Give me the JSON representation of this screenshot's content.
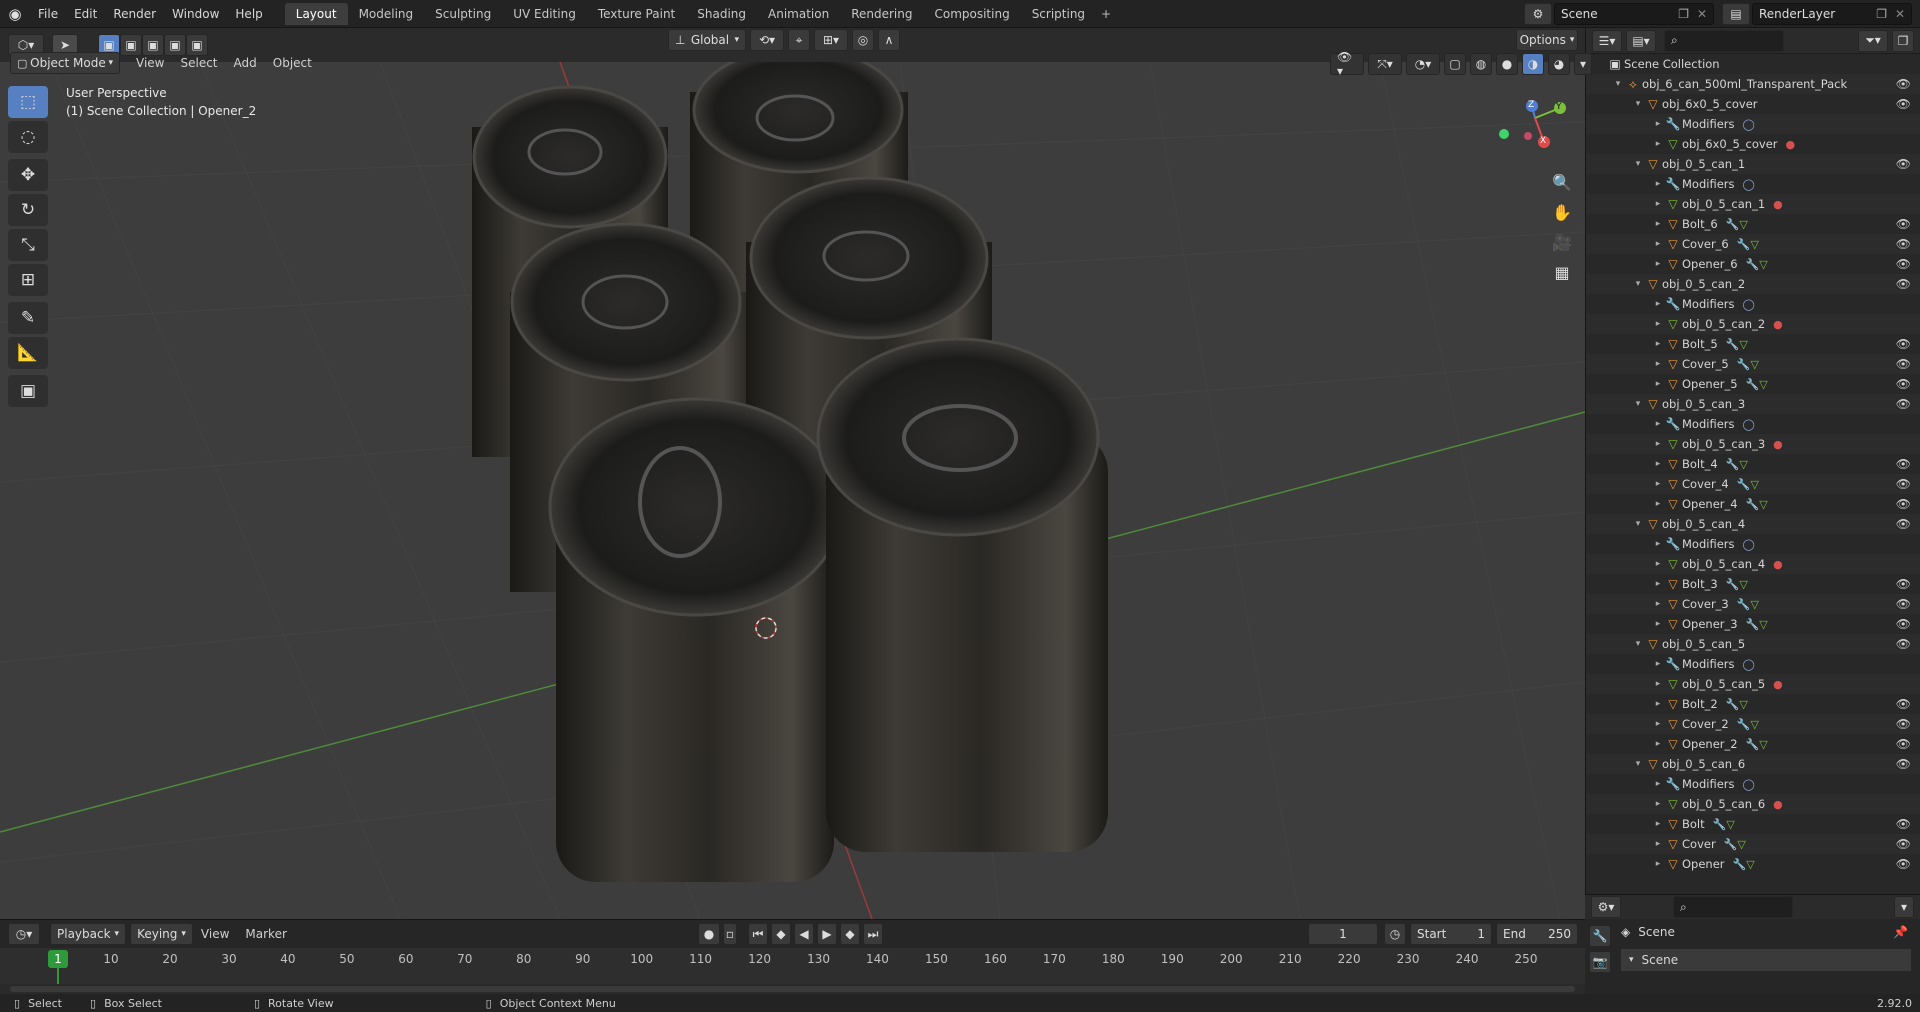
{
  "menubar": {
    "logo_icon": "blender-logo-icon",
    "items": [
      "File",
      "Edit",
      "Render",
      "Window",
      "Help"
    ]
  },
  "workspaces": {
    "tabs": [
      "Layout",
      "Modeling",
      "Sculpting",
      "UV Editing",
      "Texture Paint",
      "Shading",
      "Animation",
      "Rendering",
      "Compositing",
      "Scripting"
    ],
    "active": "Layout",
    "add": "+"
  },
  "scene": {
    "name": "Scene",
    "render_layer": "RenderLayer"
  },
  "viewport_header": {
    "mode": "Object Mode",
    "menus": [
      "View",
      "Select",
      "Add",
      "Object"
    ],
    "transform": "Global",
    "options": "Options"
  },
  "viewport": {
    "perspective": "User Perspective",
    "context": "(1) Scene Collection | Opener_2",
    "gizmo": {
      "x": "X",
      "y": "Y",
      "z": "Z"
    }
  },
  "outliner": {
    "root": "Scene Collection",
    "rows": [
      {
        "indent": 1,
        "expand": "▾",
        "icon": "empty",
        "label": "obj_6_can_500ml_Transparent_Pack",
        "eye": true
      },
      {
        "indent": 2,
        "expand": "▾",
        "icon": "object",
        "label": "obj_6x0_5_cover",
        "eye": true
      },
      {
        "indent": 3,
        "expand": "▸",
        "icon": "wrench",
        "label": "Modifiers",
        "tag": "mod",
        "eye": false
      },
      {
        "indent": 3,
        "expand": "▸",
        "icon": "mesh",
        "label": "obj_6x0_5_cover",
        "tag": "mat",
        "eye": false
      },
      {
        "indent": 2,
        "expand": "▾",
        "icon": "object",
        "label": "obj_0_5_can_1",
        "eye": true
      },
      {
        "indent": 3,
        "expand": "▸",
        "icon": "wrench",
        "label": "Modifiers",
        "tag": "mod",
        "eye": false
      },
      {
        "indent": 3,
        "expand": "▸",
        "icon": "mesh",
        "label": "obj_0_5_can_1",
        "tag": "mat",
        "eye": false
      },
      {
        "indent": 3,
        "expand": "▸",
        "icon": "object",
        "label": "Bolt_6",
        "tag": "wm",
        "eye": true
      },
      {
        "indent": 3,
        "expand": "▸",
        "icon": "object",
        "label": "Cover_6",
        "tag": "wm",
        "eye": true
      },
      {
        "indent": 3,
        "expand": "▸",
        "icon": "object",
        "label": "Opener_6",
        "tag": "wm",
        "eye": true
      },
      {
        "indent": 2,
        "expand": "▾",
        "icon": "object",
        "label": "obj_0_5_can_2",
        "eye": true
      },
      {
        "indent": 3,
        "expand": "▸",
        "icon": "wrench",
        "label": "Modifiers",
        "tag": "mod",
        "eye": false
      },
      {
        "indent": 3,
        "expand": "▸",
        "icon": "mesh",
        "label": "obj_0_5_can_2",
        "tag": "mat",
        "eye": false
      },
      {
        "indent": 3,
        "expand": "▸",
        "icon": "object",
        "label": "Bolt_5",
        "tag": "wm",
        "eye": true
      },
      {
        "indent": 3,
        "expand": "▸",
        "icon": "object",
        "label": "Cover_5",
        "tag": "wm",
        "eye": true
      },
      {
        "indent": 3,
        "expand": "▸",
        "icon": "object",
        "label": "Opener_5",
        "tag": "wm",
        "eye": true
      },
      {
        "indent": 2,
        "expand": "▾",
        "icon": "object",
        "label": "obj_0_5_can_3",
        "eye": true
      },
      {
        "indent": 3,
        "expand": "▸",
        "icon": "wrench",
        "label": "Modifiers",
        "tag": "mod",
        "eye": false
      },
      {
        "indent": 3,
        "expand": "▸",
        "icon": "mesh",
        "label": "obj_0_5_can_3",
        "tag": "mat",
        "eye": false
      },
      {
        "indent": 3,
        "expand": "▸",
        "icon": "object",
        "label": "Bolt_4",
        "tag": "wm",
        "eye": true
      },
      {
        "indent": 3,
        "expand": "▸",
        "icon": "object",
        "label": "Cover_4",
        "tag": "wm",
        "eye": true
      },
      {
        "indent": 3,
        "expand": "▸",
        "icon": "object",
        "label": "Opener_4",
        "tag": "wm",
        "eye": true
      },
      {
        "indent": 2,
        "expand": "▾",
        "icon": "object",
        "label": "obj_0_5_can_4",
        "eye": true
      },
      {
        "indent": 3,
        "expand": "▸",
        "icon": "wrench",
        "label": "Modifiers",
        "tag": "mod",
        "eye": false
      },
      {
        "indent": 3,
        "expand": "▸",
        "icon": "mesh",
        "label": "obj_0_5_can_4",
        "tag": "mat",
        "eye": false
      },
      {
        "indent": 3,
        "expand": "▸",
        "icon": "object",
        "label": "Bolt_3",
        "tag": "wm",
        "eye": true
      },
      {
        "indent": 3,
        "expand": "▸",
        "icon": "object",
        "label": "Cover_3",
        "tag": "wm",
        "eye": true
      },
      {
        "indent": 3,
        "expand": "▸",
        "icon": "object",
        "label": "Opener_3",
        "tag": "wm",
        "eye": true
      },
      {
        "indent": 2,
        "expand": "▾",
        "icon": "object",
        "label": "obj_0_5_can_5",
        "eye": true
      },
      {
        "indent": 3,
        "expand": "▸",
        "icon": "wrench",
        "label": "Modifiers",
        "tag": "mod",
        "eye": false
      },
      {
        "indent": 3,
        "expand": "▸",
        "icon": "mesh",
        "label": "obj_0_5_can_5",
        "tag": "mat",
        "eye": false
      },
      {
        "indent": 3,
        "expand": "▸",
        "icon": "object",
        "label": "Bolt_2",
        "tag": "wm",
        "eye": true
      },
      {
        "indent": 3,
        "expand": "▸",
        "icon": "object",
        "label": "Cover_2",
        "tag": "wm",
        "eye": true
      },
      {
        "indent": 3,
        "expand": "▸",
        "icon": "object",
        "label": "Opener_2",
        "tag": "wm",
        "eye": true
      },
      {
        "indent": 2,
        "expand": "▾",
        "icon": "object",
        "label": "obj_0_5_can_6",
        "eye": true
      },
      {
        "indent": 3,
        "expand": "▸",
        "icon": "wrench",
        "label": "Modifiers",
        "tag": "mod",
        "eye": false
      },
      {
        "indent": 3,
        "expand": "▸",
        "icon": "mesh",
        "label": "obj_0_5_can_6",
        "tag": "mat",
        "eye": false
      },
      {
        "indent": 3,
        "expand": "▸",
        "icon": "object",
        "label": "Bolt",
        "tag": "wm",
        "eye": true
      },
      {
        "indent": 3,
        "expand": "▸",
        "icon": "object",
        "label": "Cover",
        "tag": "wm",
        "eye": true
      },
      {
        "indent": 3,
        "expand": "▸",
        "icon": "object",
        "label": "Opener",
        "tag": "wm",
        "eye": true
      }
    ]
  },
  "properties": {
    "scene_label": "Scene",
    "panel": "Scene"
  },
  "timeline": {
    "menus": [
      "Playback",
      "Keying",
      "View",
      "Marker"
    ],
    "current_frame": "1",
    "start_label": "Start",
    "start": "1",
    "end_label": "End",
    "end": "250",
    "ticks": [
      "10",
      "20",
      "30",
      "40",
      "50",
      "60",
      "70",
      "80",
      "90",
      "100",
      "110",
      "120",
      "130",
      "140",
      "150",
      "160",
      "170",
      "180",
      "190",
      "200",
      "210",
      "220",
      "230",
      "240",
      "250"
    ],
    "playhead": "1"
  },
  "statusbar": {
    "select": "Select",
    "box_select": "Box Select",
    "rotate": "Rotate View",
    "context_menu": "Object Context Menu",
    "version": "2.92.0"
  },
  "colors": {
    "accent": "#5680c2",
    "active_frame": "#2f9a3b",
    "x_axis": "#e04a4a",
    "y_axis": "#7bbf3b",
    "object_orange": "#e8943a",
    "mesh_green": "#7bbf3b"
  }
}
